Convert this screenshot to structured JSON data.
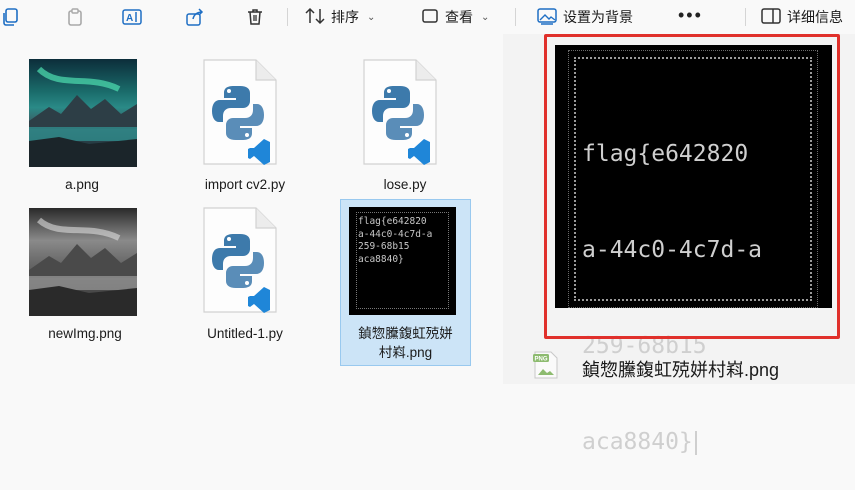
{
  "toolbar": {
    "sort_label": "排序",
    "view_label": "查看",
    "set_background_label": "设置为背景",
    "more_label": "•••",
    "details_label": "详细信息"
  },
  "files": [
    {
      "name": "a.png",
      "type": "image-color"
    },
    {
      "name": "import cv2.py",
      "type": "python"
    },
    {
      "name": "lose.py",
      "type": "python"
    },
    {
      "name": "newImg.png",
      "type": "image-gray"
    },
    {
      "name": "Untitled-1.py",
      "type": "python"
    },
    {
      "name": "鍞惣黱鍑虹殑姘村嵙.png",
      "type": "image-flag",
      "selected": true
    }
  ],
  "selected_file_label_line1": "鍞惣黱鍑虹殑姘",
  "selected_file_label_line2": "村嵙.png",
  "preview": {
    "flag_lines": [
      "flag{e642820",
      "a-44c0-4c7d-a",
      "259-68b15",
      "aca8840}"
    ],
    "file_name": "鍞惣黱鍑虹殑姘村嵙.png",
    "file_badge": "PNG"
  },
  "colors": {
    "accent_red": "#e0302b",
    "selection": "#cce4f7",
    "vscode_blue": "#1f86d8",
    "python_blue": "#3d7aab",
    "python_yellow": "#5a8db8"
  }
}
